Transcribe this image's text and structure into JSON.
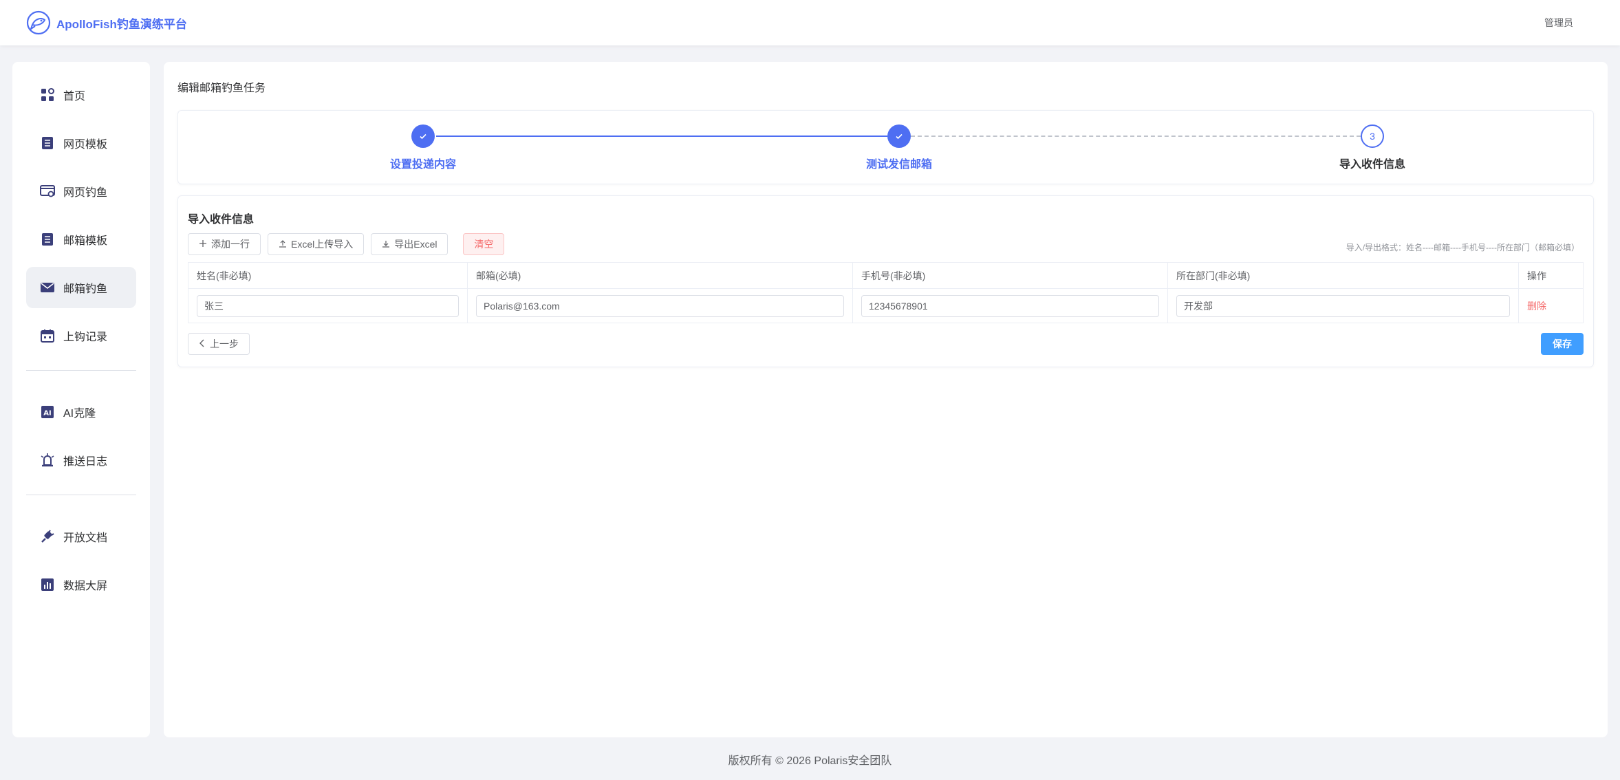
{
  "header": {
    "brand_name": "ApolloFish钓鱼演练平台",
    "user_name": "管理员",
    "accent_color": "#4e6ef2"
  },
  "sidebar": {
    "items": [
      {
        "label": "首页",
        "icon": "dashboard-icon"
      },
      {
        "label": "网页模板",
        "icon": "document-icon"
      },
      {
        "label": "网页钓鱼",
        "icon": "browser-icon"
      },
      {
        "label": "邮箱模板",
        "icon": "document-icon"
      },
      {
        "label": "邮箱钓鱼",
        "icon": "mail-icon",
        "active": true
      },
      {
        "label": "上钩记录",
        "icon": "calendar-icon"
      },
      {
        "label": "AI克隆",
        "icon": "ai-icon"
      },
      {
        "label": "推送日志",
        "icon": "alarm-icon"
      },
      {
        "label": "开放文档",
        "icon": "plug-icon"
      },
      {
        "label": "数据大屏",
        "icon": "bar-chart-icon"
      }
    ]
  },
  "main": {
    "title": "编辑邮箱钓鱼任务",
    "steps": [
      {
        "title": "设置投递内容",
        "status": "done"
      },
      {
        "title": "测试发信邮箱",
        "status": "done"
      },
      {
        "title": "导入收件信息",
        "status": "current",
        "number": "3"
      }
    ],
    "import": {
      "section_title": "导入收件信息",
      "buttons": {
        "add_row": "添加一行",
        "excel_upload": "Excel上传导入",
        "export_excel": "导出Excel",
        "clear": "清空"
      },
      "hint": "导入/导出格式：姓名----邮箱----手机号----所在部门（邮箱必填）",
      "columns": [
        "姓名(非必填)",
        "邮箱(必填)",
        "手机号(非必填)",
        "所在部门(非必填)",
        "操作"
      ],
      "rows": [
        {
          "name": "张三",
          "email": "Polaris@163.com",
          "phone": "12345678901",
          "department": "开发部",
          "action": "删除"
        }
      ]
    },
    "prev_button": "上一步",
    "save_button": "保存"
  },
  "footer": {
    "copyright": "版权所有 © 2026 Polaris安全团队"
  }
}
